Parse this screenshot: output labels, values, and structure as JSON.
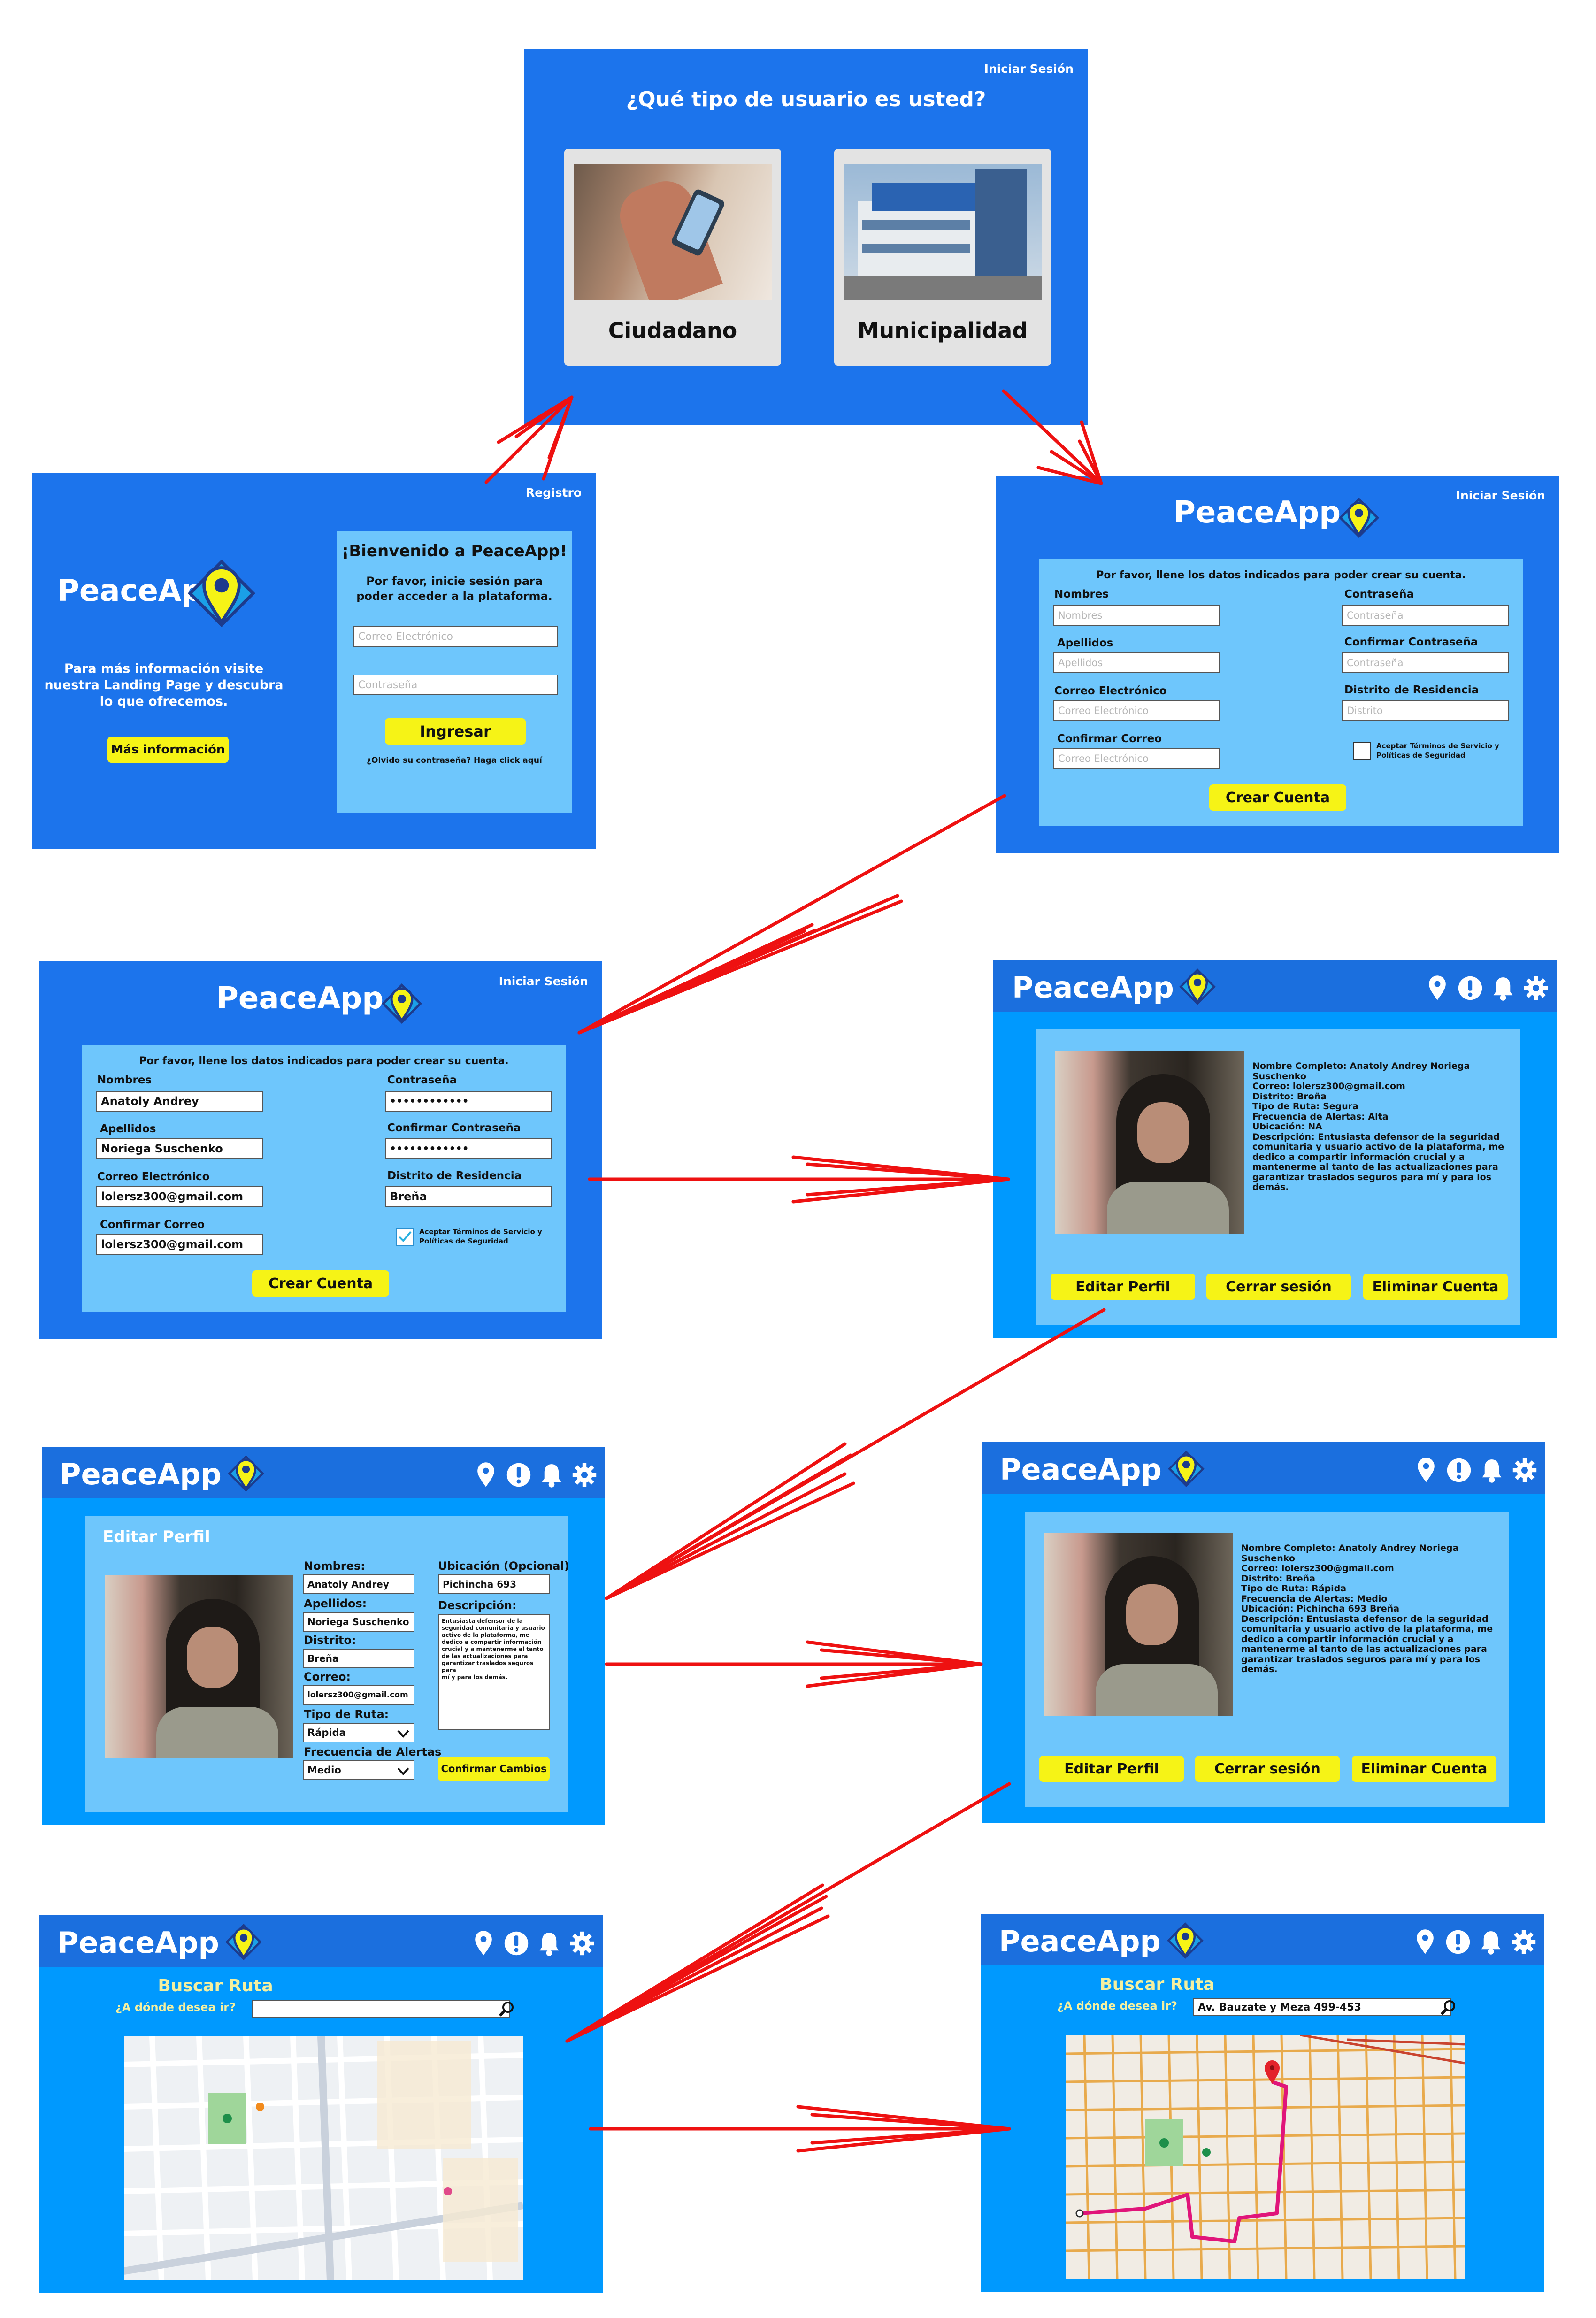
{
  "user_type": {
    "login_link": "Iniciar Sesión",
    "title": "¿Qué tipo de usuario es usted?",
    "options": [
      "Ciudadano",
      "Municipalidad"
    ]
  },
  "login": {
    "register_link": "Registro",
    "brand": "PeaceApp",
    "info_text": [
      "Para más información visite",
      "nuestra Landing Page y descubra",
      "lo que ofrecemos."
    ],
    "more_info_button": "Más información",
    "welcome": "¡Bienvenido a PeaceApp!",
    "subtitle": [
      "Por favor, inicie sesión para",
      "poder acceder a la plataforma."
    ],
    "email_placeholder": "Correo Electrónico",
    "password_placeholder": "Contraseña",
    "login_button": "Ingresar",
    "forgot": "¿Olvido su contraseña? Haga click aquí"
  },
  "register": {
    "login_link": "Iniciar Sesión",
    "brand": "PeaceApp",
    "instruction": "Por favor, llene los datos indicados para poder crear su cuenta.",
    "labels": {
      "names": "Nombres",
      "surnames": "Apellidos",
      "email": "Correo Electrónico",
      "confirm_email": "Confirmar Correo",
      "password": "Contraseña",
      "confirm_password": "Confirmar Contraseña",
      "district": "Distrito de Residencia"
    },
    "placeholders": {
      "names": "Nombres",
      "surnames": "Apellidos",
      "email": "Correo Electrónico",
      "confirm_email": "Correo Electrónico",
      "password": "Contraseña",
      "confirm_password": "Contraseña",
      "district": "Distrito"
    },
    "terms": [
      "Aceptar Términos de Servicio y",
      "Políticas de Seguridad"
    ],
    "create_button": "Crear Cuenta"
  },
  "register_filled": {
    "values": {
      "names": "Anatoly Andrey",
      "surnames": "Noriega Suschenko",
      "email": "lolersz300@gmail.com",
      "confirm_email": "lolersz300@gmail.com",
      "password": "••••••••••••",
      "confirm_password": "••••••••••••",
      "district": "Breña"
    },
    "terms_checked": true
  },
  "profile": {
    "brand": "PeaceApp",
    "lines_before": [
      "Nombre Completo: Anatoly Andrey Noriega",
      "Suschenko",
      "Correo: lolersz300@gmail.com",
      "Distrito: Breña",
      "Tipo de Ruta: Segura",
      "Frecuencia de Alertas: Alta",
      "Ubicación: NA",
      "Descripción: Entusiasta defensor de la seguridad",
      "comunitaria y usuario activo de la plataforma, me",
      "dedico a compartir información crucial y a",
      "mantenerme al tanto de las actualizaciones para",
      "garantizar traslados seguros para mí y para los",
      "demás."
    ],
    "lines_after": [
      "Nombre Completo: Anatoly Andrey Noriega",
      "Suschenko",
      "Correo: lolersz300@gmail.com",
      "Distrito: Breña",
      "Tipo de Ruta: Rápida",
      "Frecuencia de Alertas: Medio",
      "Ubicación: Pichincha 693 Breña",
      "Descripción: Entusiasta defensor de la seguridad",
      "comunitaria y usuario activo de la plataforma, me",
      "dedico a compartir información crucial y a",
      "mantenerme al tanto de las actualizaciones para",
      "garantizar traslados seguros para mí y para los",
      "demás."
    ],
    "buttons": [
      "Editar Perfil",
      "Cerrar sesión",
      "Eliminar Cuenta"
    ]
  },
  "edit_profile": {
    "title": "Editar Perfil",
    "labels": {
      "names": "Nombres:",
      "surnames": "Apellidos:",
      "district": "Distrito:",
      "email": "Correo:",
      "route_type": "Tipo de Ruta:",
      "alert_freq": "Frecuencia de Alertas",
      "location": "Ubicación (Opcional)",
      "description": "Descripción:"
    },
    "values": {
      "names": "Anatoly Andrey",
      "surnames": "Noriega Suschenko",
      "district": "Breña",
      "email": "lolersz300@gmail.com",
      "route_type": "Rápida",
      "alert_freq": "Medio",
      "location": "Pichincha 693",
      "description": [
        "Entusiasta defensor de la",
        "seguridad comunitaria y usuario",
        "activo de la plataforma, me",
        "dedico a compartir información",
        "crucial y a mantenerme al tanto",
        "de las actualizaciones para",
        "garantizar traslados seguros para",
        "mí y para los demás."
      ]
    },
    "confirm_button": "Confirmar Cambios"
  },
  "route": {
    "title": "Buscar Ruta",
    "question": "¿A dónde desea ir?",
    "destination": "Av. Bauzate y Meza 499-453"
  },
  "icons": [
    "location-pin-icon",
    "alert-icon",
    "bell-icon",
    "gear-icon",
    "search-icon"
  ],
  "colors": {
    "primary_blue": "#1c74ec",
    "bright_blue": "#0099fe",
    "light_blue": "#6ec6fc",
    "button_yellow": "#f6f316",
    "arrow_red": "#ee1111"
  }
}
